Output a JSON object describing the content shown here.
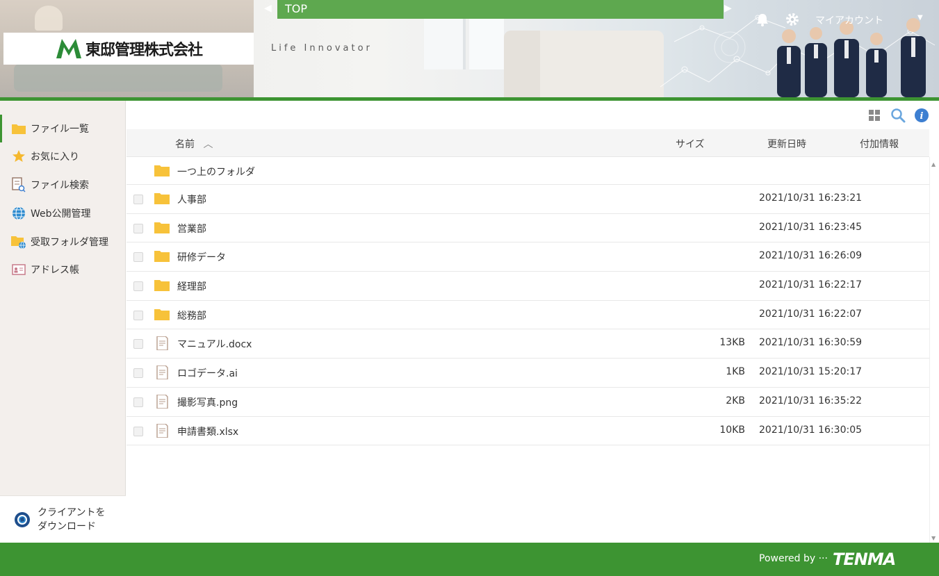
{
  "header": {
    "company_name": "東邸管理株式会社",
    "tagline": "Life Innovator",
    "breadcrumb": "TOP",
    "account_label": "マイアカウント"
  },
  "sidebar": {
    "items": [
      {
        "label": "ファイル一覧",
        "icon": "folder-icon",
        "active": true
      },
      {
        "label": "お気に入り",
        "icon": "star-icon"
      },
      {
        "label": "ファイル検索",
        "icon": "file-search-icon"
      },
      {
        "label": "Web公開管理",
        "icon": "globe-icon"
      },
      {
        "label": "受取フォルダ管理",
        "icon": "folder-globe-icon"
      },
      {
        "label": "アドレス帳",
        "icon": "address-card-icon"
      }
    ],
    "download_line1": "クライアントを",
    "download_line2": "ダウンロード"
  },
  "table": {
    "columns": {
      "name": "名前",
      "size": "サイズ",
      "updated": "更新日時",
      "extra": "付加情報"
    },
    "parent_folder": "一つ上のフォルダ",
    "rows": [
      {
        "name": "人事部",
        "type": "folder",
        "size": "",
        "updated": "2021/10/31 16:23:21"
      },
      {
        "name": "営業部",
        "type": "folder",
        "size": "",
        "updated": "2021/10/31 16:23:45"
      },
      {
        "name": "研修データ",
        "type": "folder",
        "size": "",
        "updated": "2021/10/31 16:26:09"
      },
      {
        "name": "経理部",
        "type": "folder",
        "size": "",
        "updated": "2021/10/31 16:22:17"
      },
      {
        "name": "総務部",
        "type": "folder",
        "size": "",
        "updated": "2021/10/31 16:22:07"
      },
      {
        "name": "マニュアル.docx",
        "type": "file",
        "size": "13KB",
        "updated": "2021/10/31 16:30:59"
      },
      {
        "name": "ロゴデータ.ai",
        "type": "file",
        "size": "1KB",
        "updated": "2021/10/31 15:20:17"
      },
      {
        "name": "撮影写真.png",
        "type": "file",
        "size": "2KB",
        "updated": "2021/10/31 16:35:22"
      },
      {
        "name": "申請書類.xlsx",
        "type": "file",
        "size": "10KB",
        "updated": "2021/10/31 16:30:05"
      }
    ]
  },
  "footer": {
    "powered_by": "Powered by ···",
    "brand": "TENMA"
  },
  "colors": {
    "brand_green": "#3d9432",
    "breadcrumb_green": "#5ea84f",
    "folder_yellow": "#f7c23a",
    "info_blue": "#3d7fd1"
  }
}
